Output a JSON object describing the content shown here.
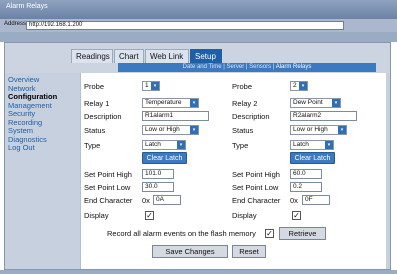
{
  "window": {
    "title": "Alarm Relays"
  },
  "address": {
    "label": "Address",
    "url": "http://192.168.1.200"
  },
  "tabs": [
    {
      "label": "Readings",
      "active": false
    },
    {
      "label": "Chart",
      "active": false
    },
    {
      "label": "Web Link",
      "active": false
    },
    {
      "label": "Setup",
      "active": true
    }
  ],
  "subnav": {
    "items": [
      "Date and Time",
      "Server",
      "Sensors",
      "Alarm Relays"
    ],
    "current": "Alarm Relays"
  },
  "sidebar": [
    {
      "label": "Overview",
      "current": false
    },
    {
      "label": "Network",
      "current": false
    },
    {
      "label": "Configuration",
      "current": true
    },
    {
      "label": "Management",
      "current": false
    },
    {
      "label": "Security",
      "current": false
    },
    {
      "label": "Recording",
      "current": false
    },
    {
      "label": "System",
      "current": false
    },
    {
      "label": "Diagnostics",
      "current": false
    },
    {
      "label": "Log Out",
      "current": false
    }
  ],
  "labels": {
    "probe": "Probe",
    "relay1": "Relay 1",
    "relay2": "Relay 2",
    "description": "Description",
    "status": "Status",
    "type": "Type",
    "clear_latch": "Clear Latch",
    "sp_high": "Set Point High",
    "sp_low": "Set Point Low",
    "end_char": "End Character",
    "hex_prefix": "0x",
    "display": "Display",
    "record": "Record all alarm events on the flash memory",
    "retrieve": "Retrieve",
    "save": "Save Changes",
    "reset": "Reset"
  },
  "left": {
    "probe": "1",
    "relay": "Temperature",
    "description": "R1alarm1",
    "status": "Low or High",
    "type": "Latch",
    "sp_high": "101.0",
    "sp_low": "30.0",
    "end_char": "0A",
    "display": true
  },
  "right": {
    "probe": "2",
    "relay": "Dew Point",
    "description": "R2alarm2",
    "status": "Low or High",
    "type": "Latch",
    "sp_high": "60.0",
    "sp_low": "0.2",
    "end_char": "0F",
    "display": true
  },
  "record_checked": true,
  "colors": {
    "accent": "#1e5fa8",
    "panel": "#c6d0df",
    "nav_link": "#1e5fa8"
  }
}
